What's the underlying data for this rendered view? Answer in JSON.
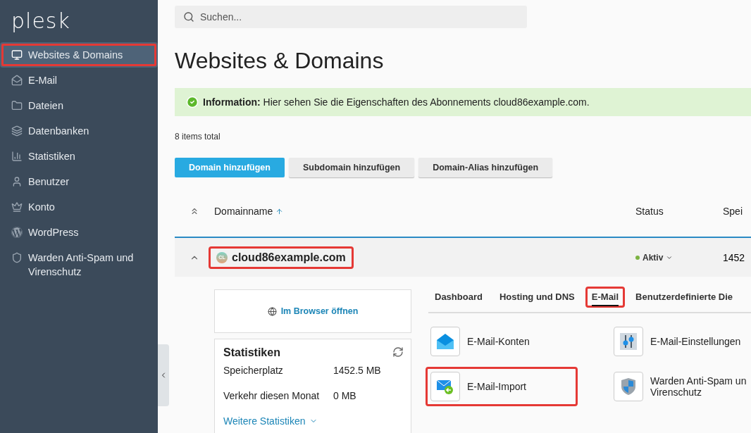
{
  "sidebar": {
    "logo": "plesk",
    "items": [
      {
        "label": "Websites & Domains",
        "selected": true,
        "highlighted": true
      },
      {
        "label": "E-Mail",
        "selected": false,
        "highlighted": false
      },
      {
        "label": "Dateien",
        "selected": false,
        "highlighted": false
      },
      {
        "label": "Datenbanken",
        "selected": false,
        "highlighted": false
      },
      {
        "label": "Statistiken",
        "selected": false,
        "highlighted": false
      },
      {
        "label": "Benutzer",
        "selected": false,
        "highlighted": false
      },
      {
        "label": "Konto",
        "selected": false,
        "highlighted": false
      },
      {
        "label": "WordPress",
        "selected": false,
        "highlighted": false
      },
      {
        "label": "Warden Anti-Spam und Virenschutz",
        "selected": false,
        "highlighted": false
      }
    ]
  },
  "search": {
    "placeholder": "Suchen..."
  },
  "page_title": "Websites & Domains",
  "info": {
    "label": "Information:",
    "text": "Hier sehen Sie die Eigenschaften des Abonnements cloud86example.com."
  },
  "items_total": "8 items total",
  "buttons": [
    {
      "label": "Domain hinzufügen",
      "primary": true
    },
    {
      "label": "Subdomain hinzufügen",
      "primary": false
    },
    {
      "label": "Domain-Alias hinzufügen",
      "primary": false
    }
  ],
  "table": {
    "columns": [
      "Domainname",
      "Status",
      "Spei"
    ],
    "row": {
      "avatar": "CL",
      "domain": "cloud86example.com",
      "highlighted": true,
      "expanded": true,
      "status": "Aktiv",
      "column_3": "1452"
    }
  },
  "details": {
    "open_link": "Im Browser öffnen",
    "stats": {
      "title": "Statistiken",
      "rows": [
        {
          "label": "Speicherplatz",
          "value": "1452.5 MB"
        },
        {
          "label": "Verkehr diesen Monat",
          "value": "0 MB"
        }
      ],
      "more": "Weitere Statistiken"
    },
    "tabs": [
      {
        "label": "Dashboard",
        "selected": false,
        "highlighted": false
      },
      {
        "label": "Hosting und DNS",
        "selected": false,
        "highlighted": false
      },
      {
        "label": "E-Mail",
        "selected": true,
        "highlighted": true
      },
      {
        "label": "Benutzerdefinierte Die",
        "selected": false,
        "highlighted": false
      }
    ],
    "tools": [
      {
        "kind": "accounts",
        "label": "E-Mail-Konten",
        "highlighted": false
      },
      {
        "kind": "settings",
        "label": "E-Mail-Einstellungen",
        "highlighted": false
      },
      {
        "kind": "import",
        "label": "E-Mail-Import",
        "highlighted": true
      },
      {
        "kind": "shield",
        "label": "Warden Anti-Spam un\nVirenschutz",
        "highlighted": false
      }
    ]
  }
}
